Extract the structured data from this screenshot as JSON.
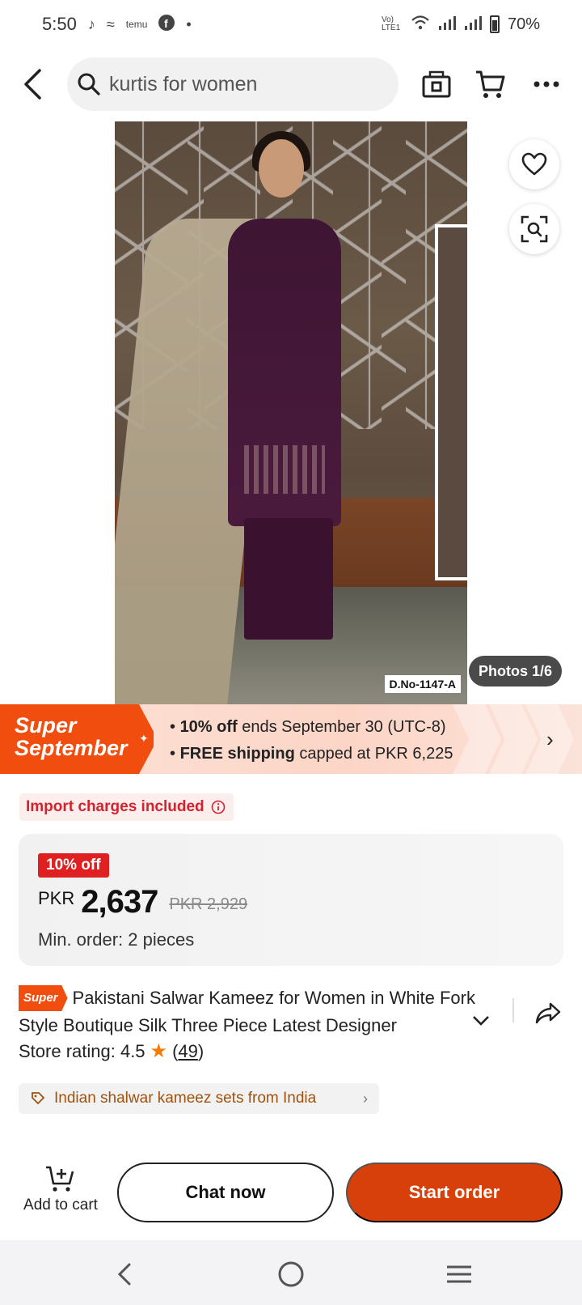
{
  "status_bar": {
    "time": "5:50",
    "battery": "70%",
    "network_label": "Vo) LTE1"
  },
  "header": {
    "search_query": "kurtis for women"
  },
  "hero": {
    "design_no": "D.No-1147-A",
    "photos_badge": "Photos 1/6"
  },
  "promo": {
    "tag_line1": "Super",
    "tag_line2": "September",
    "line1_bold": "10% off",
    "line1_rest": " ends September 30 (UTC-8)",
    "line2_bold": "FREE shipping",
    "line2_rest": " capped at PKR 6,225"
  },
  "import_notice": "Import charges included",
  "price": {
    "discount_badge": "10% off",
    "currency": "PKR",
    "amount": "2,637",
    "original": "PKR 2,929",
    "min_order": "Min. order: 2 pieces"
  },
  "product": {
    "super_badge": "Super",
    "title": "Pakistani Salwar Kameez for Women in White Fork Style Boutique Silk Three Piece Latest Designer",
    "rating_label": "Store rating: 4.5",
    "rating_count_open": "(",
    "rating_count": "49",
    "rating_count_close": ")",
    "category_chip": "Indian shalwar kameez sets from India"
  },
  "actions": {
    "add_to_cart": "Add to cart",
    "chat_now": "Chat now",
    "start_order": "Start order"
  },
  "colors": {
    "accent_orange": "#d8400b",
    "promo_orange": "#f14d0f",
    "discount_red": "#e02020",
    "import_red": "#d5232e",
    "star": "#f57c00",
    "category_brown": "#a0520e"
  }
}
